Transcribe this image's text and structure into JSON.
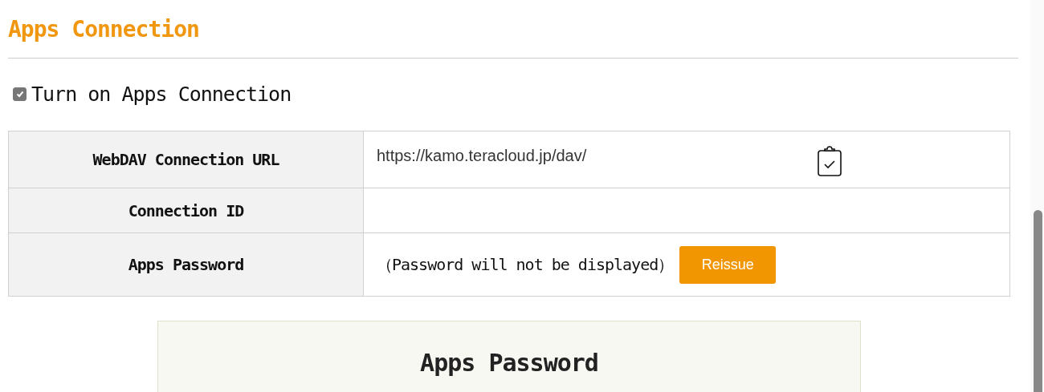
{
  "heading": "Apps Connection",
  "toggle": {
    "label": "Turn on Apps Connection",
    "checked": true
  },
  "rows": [
    {
      "kind": "url",
      "label": "WebDAV Connection URL",
      "value": "https://kamo.teracloud.jp/dav/"
    },
    {
      "kind": "empty",
      "label": "Connection ID"
    },
    {
      "kind": "password",
      "label": "Apps Password",
      "note": "（Password will not be displayed）",
      "button": "Reissue"
    }
  ],
  "panel": {
    "title": "Apps Password"
  }
}
